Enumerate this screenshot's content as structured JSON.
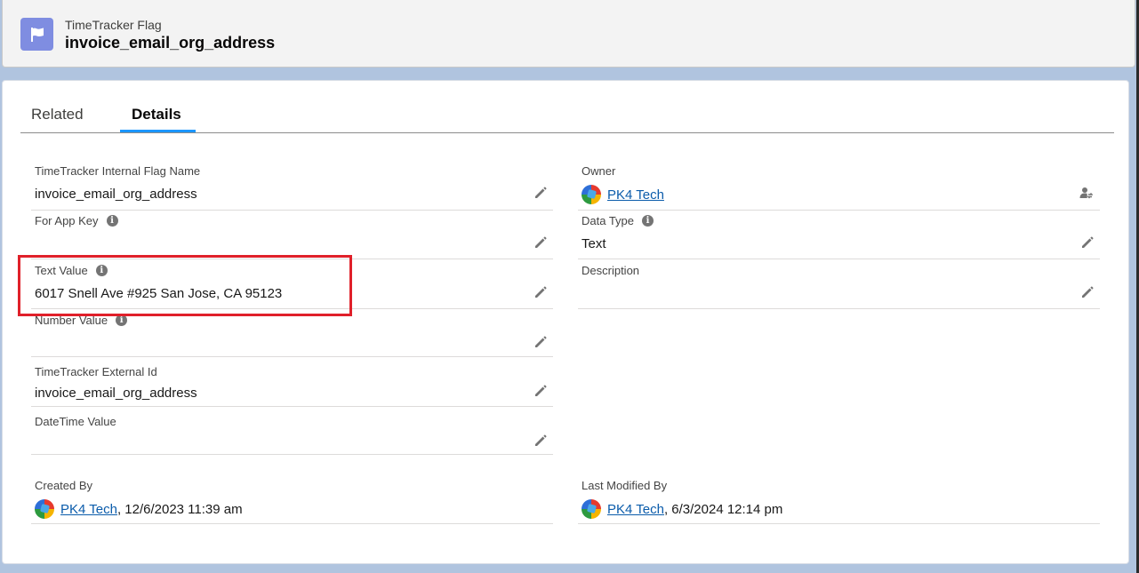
{
  "header": {
    "object_type": "TimeTracker Flag",
    "record_title": "invoice_email_org_address"
  },
  "tabs": [
    {
      "label": "Related"
    },
    {
      "label": "Details"
    }
  ],
  "left_fields": [
    {
      "label": "TimeTracker Internal Flag Name",
      "value": "invoice_email_org_address",
      "info": false
    },
    {
      "label": "For App Key",
      "value": "",
      "info": true
    },
    {
      "label": "Text Value",
      "value": "6017 Snell Ave #925 San Jose, CA 95123",
      "info": true
    },
    {
      "label": "Number Value",
      "value": "",
      "info": true
    },
    {
      "label": "TimeTracker External Id",
      "value": "invoice_email_org_address",
      "info": false
    },
    {
      "label": "DateTime Value",
      "value": "",
      "info": false
    }
  ],
  "right_fields": {
    "owner": {
      "label": "Owner",
      "user": "PK4 Tech"
    },
    "data_type": {
      "label": "Data Type",
      "value": "Text"
    },
    "description": {
      "label": "Description",
      "value": ""
    }
  },
  "system_fields": {
    "created_by": {
      "label": "Created By",
      "user": "PK4 Tech",
      "timestamp": ", 12/6/2023 11:39 am"
    },
    "last_modified_by": {
      "label": "Last Modified By",
      "user": "PK4 Tech",
      "timestamp": ", 6/3/2024 12:14 pm"
    }
  },
  "icons": {
    "header": "flag-icon",
    "edit": "pencil-icon",
    "info": "info-icon",
    "change_owner": "change-owner-icon"
  },
  "colors": {
    "header_icon_bg": "#7f8de1",
    "tab_active": "#1b96ff",
    "link": "#0b5cab",
    "highlight": "#e0202a"
  }
}
